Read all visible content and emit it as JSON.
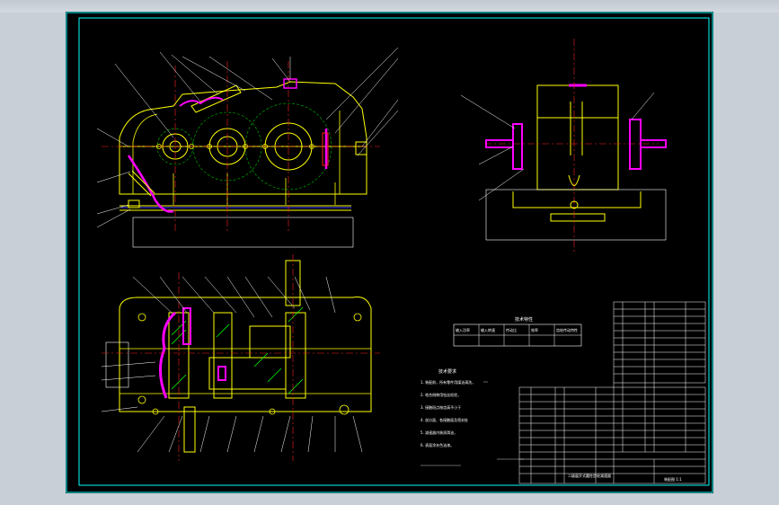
{
  "drawing": {
    "kind": "cad-assembly-drawing",
    "colors": {
      "background": "#000000",
      "frame": "#00ffff",
      "part_outline": "#ffff00",
      "leader": "#ffffff",
      "center_line": "#ff2020",
      "gasket": "#ff00ff",
      "hatch": "#00ff00",
      "gear_circle": "#00c000",
      "dimension": "#9090ff"
    },
    "views": {
      "front": {
        "name": "front-view"
      },
      "side": {
        "name": "side-view"
      },
      "plan": {
        "name": "plan-view"
      }
    },
    "spec_table": {
      "title": "技术特性",
      "header": [
        "输入功率",
        "输入转速",
        "传动比",
        "效率",
        "齿轮传动特性"
      ],
      "row": [
        "",
        "",
        "",
        "",
        ""
      ]
    },
    "tech_requirements": {
      "title": "技术要求",
      "items": [
        "1. 装配前，所有零件用煤油清洗，",
        "2. 啮合侧隙用铅丝检验，",
        "3. 接触斑点按齿高不小于",
        "4. 剖分面、各接触面及密封处",
        "5. 减速器内装润滑油，",
        "6. 表面涂灰色油漆。"
      ]
    },
    "title_block": {
      "drawing_title": "二级展开式圆柱齿轮减速器",
      "drawing_number": "装配图 1:1"
    }
  }
}
